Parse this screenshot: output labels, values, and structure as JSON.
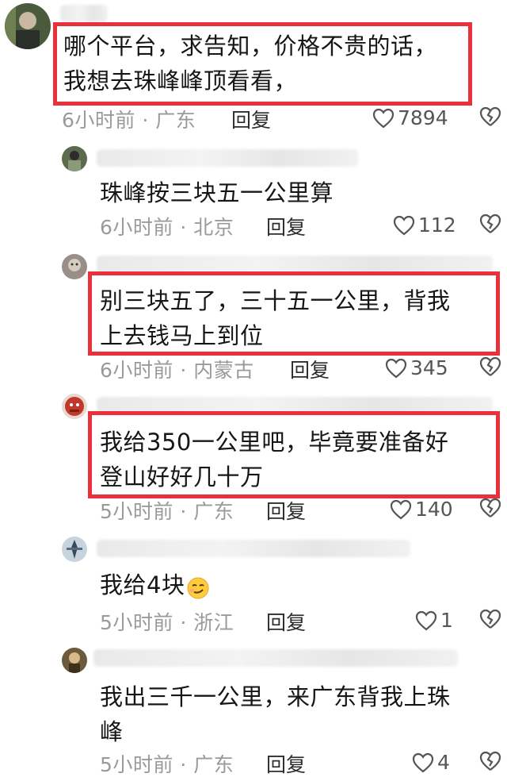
{
  "comments": [
    {
      "text_lines": [
        "哪个平台，求告知，价格不贵的话，",
        "我想去珠峰峰顶看看，"
      ],
      "meta": "6小时前 · 广东",
      "reply": "回复",
      "likes": "7894"
    },
    {
      "text_lines": [
        "珠峰按三块五一公里算"
      ],
      "meta": "6小时前 · 北京",
      "reply": "回复",
      "likes": "112"
    },
    {
      "text_lines": [
        "别三块五了，三十五一公里，背我",
        "上去钱马上到位"
      ],
      "meta": "6小时前 · 内蒙古",
      "reply": "回复",
      "likes": "345"
    },
    {
      "text_lines": [
        "我给350一公里吧，毕竟要准备好",
        "登山好好几十万"
      ],
      "meta": "5小时前 · 广东",
      "reply": "回复",
      "likes": "140"
    },
    {
      "text_lines": [
        "我给4块"
      ],
      "meta": "5小时前 · 浙江",
      "reply": "回复",
      "likes": "1",
      "emoji": "smirk-emoji"
    },
    {
      "text_lines": [
        "我出三千一公里，来广东背我上珠",
        "峰"
      ],
      "meta": "5小时前 · 广东",
      "reply": "回复",
      "likes": "4"
    }
  ],
  "colors": {
    "highlight": "#e8313a",
    "meta": "#9a9a9a",
    "text": "#161616"
  },
  "icons": [
    "heart-outline-icon",
    "broken-heart-icon",
    "smirk-emoji"
  ]
}
